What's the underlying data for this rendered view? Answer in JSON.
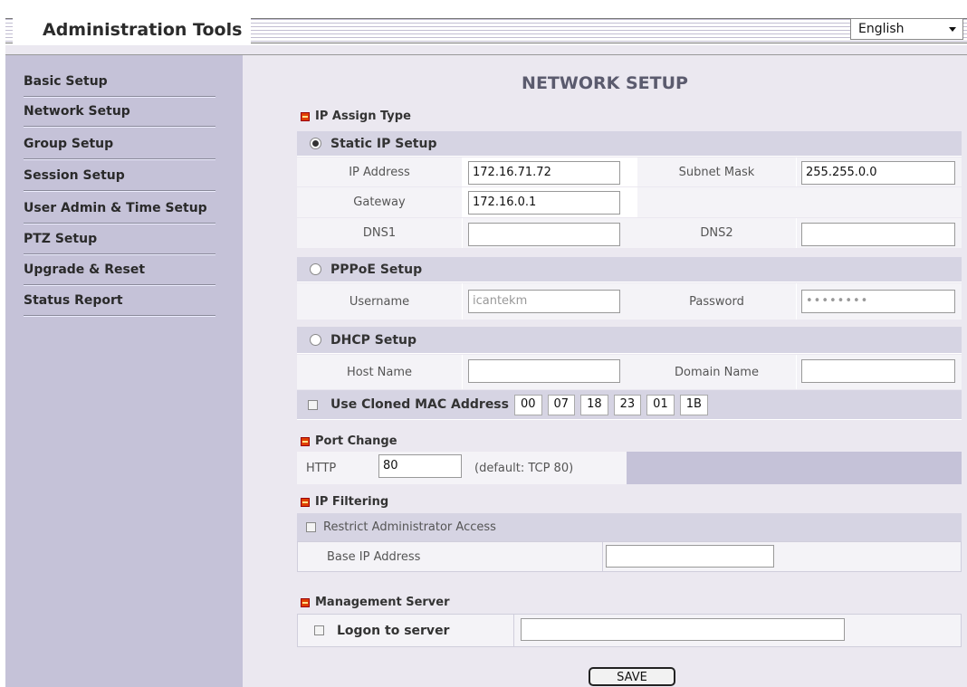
{
  "header": {
    "title": "Administration Tools",
    "language": "English"
  },
  "sidebar": {
    "items": [
      {
        "label": "Basic Setup"
      },
      {
        "label": "Network Setup"
      },
      {
        "label": "Group Setup"
      },
      {
        "label": "Session Setup"
      },
      {
        "label": "User Admin & Time Setup"
      },
      {
        "label": "PTZ Setup"
      },
      {
        "label": "Upgrade & Reset"
      },
      {
        "label": "Status Report"
      }
    ]
  },
  "page": {
    "title": "NETWORK SETUP"
  },
  "ip_assign": {
    "section_title": "IP Assign Type",
    "static": {
      "label": "Static IP Setup",
      "selected": true,
      "ip_address_label": "IP Address",
      "ip_address": "172.16.71.72",
      "subnet_mask_label": "Subnet Mask",
      "subnet_mask": "255.255.0.0",
      "gateway_label": "Gateway",
      "gateway": "172.16.0.1",
      "dns1_label": "DNS1",
      "dns1": "",
      "dns2_label": "DNS2",
      "dns2": ""
    },
    "pppoe": {
      "label": "PPPoE Setup",
      "selected": false,
      "username_label": "Username",
      "username": "icantekm",
      "password_label": "Password",
      "password": "••••••••"
    },
    "dhcp": {
      "label": "DHCP Setup",
      "selected": false,
      "host_name_label": "Host Name",
      "host_name": "",
      "domain_name_label": "Domain Name",
      "domain_name": ""
    },
    "cloned_mac": {
      "label": "Use Cloned MAC Address",
      "checked": false,
      "octets": [
        "00",
        "07",
        "18",
        "23",
        "01",
        "1B"
      ]
    }
  },
  "port_change": {
    "section_title": "Port Change",
    "http_label": "HTTP",
    "http_port": "80",
    "default_note": "(default: TCP 80)"
  },
  "ip_filtering": {
    "section_title": "IP Filtering",
    "restrict_label": "Restrict Administrator Access",
    "checked": false,
    "base_ip_label": "Base IP Address",
    "base_ip": ""
  },
  "management_server": {
    "section_title": "Management Server",
    "logon_label": "Logon to server",
    "checked": false,
    "server": ""
  },
  "save_label": "SAVE",
  "colors": {
    "sidebar": "#c5c2d8",
    "content": "#ebe8f0",
    "section_bullet": "#e04000"
  }
}
